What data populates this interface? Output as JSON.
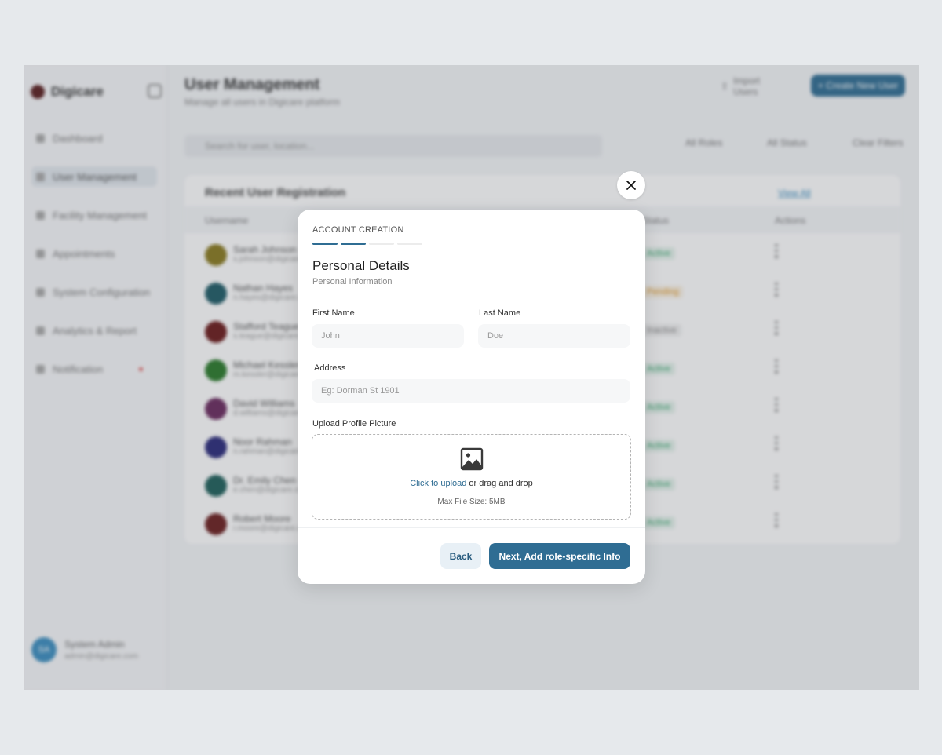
{
  "background": {
    "app_name": "Digicare",
    "page_title": "User Management",
    "page_subtitle": "Manage all users in Digicare platform",
    "import_label": "Import Users",
    "create_label": "+ Create New User",
    "search_placeholder": "Search for user, location...",
    "filters": [
      "All Roles",
      "All Status",
      "Clear Filters"
    ],
    "sidebar": [
      {
        "label": "Dashboard"
      },
      {
        "label": "User Management"
      },
      {
        "label": "Facility Management"
      },
      {
        "label": "Appointments"
      },
      {
        "label": "System Configuration"
      },
      {
        "label": "Analytics & Report"
      },
      {
        "label": "Notification"
      }
    ],
    "user_card": {
      "initials": "SA",
      "name": "System Admin",
      "email": "admin@digicare.com"
    },
    "table": {
      "title": "Recent User Registration",
      "view_all": "View All",
      "columns": [
        "Username",
        "Status",
        "Actions"
      ],
      "rows": [
        {
          "name": "Sarah Johnson",
          "email": "s.johnson@digicare.com",
          "avatar_color": "#8a7a1e",
          "status": "Active",
          "status_color": "#3aa870"
        },
        {
          "name": "Nathan Hayes",
          "email": "n.hayes@digicare.com",
          "avatar_color": "#1e5b66",
          "status": "Pending",
          "status_color": "#e09a2d"
        },
        {
          "name": "Stafford Teague",
          "email": "s.teague@digicare.com",
          "avatar_color": "#6b1a1a",
          "status": "Inactive",
          "status_color": "#888888"
        },
        {
          "name": "Michael Kessler",
          "email": "m.kessler@digicare.com",
          "avatar_color": "#2a7a2a",
          "status": "Active",
          "status_color": "#3aa870"
        },
        {
          "name": "David Williams",
          "email": "d.williams@digicare.com",
          "avatar_color": "#6a2a5e",
          "status": "Active",
          "status_color": "#3aa870"
        },
        {
          "name": "Noor Rahman",
          "email": "n.rahman@digicare.com",
          "avatar_color": "#2a2a7a",
          "status": "Active",
          "status_color": "#3aa870"
        },
        {
          "name": "Dr. Emily Chen",
          "email": "e.chen@digicare.com",
          "avatar_color": "#1e5f5a",
          "status": "Active",
          "status_color": "#3aa870"
        },
        {
          "name": "Robert Moore",
          "email": "r.moore@digicare.com",
          "avatar_color": "#6b1e1e",
          "status": "Active",
          "status_color": "#3aa870"
        }
      ]
    }
  },
  "modal": {
    "step_label": "ACCOUNT CREATION",
    "progress": {
      "total_steps": 4,
      "completed_steps": 2
    },
    "title": "Personal Details",
    "subtitle": "Personal Information",
    "first_name": {
      "label": "First Name",
      "placeholder": "John",
      "value": ""
    },
    "last_name": {
      "label": "Last Name",
      "placeholder": "Doe",
      "value": ""
    },
    "address": {
      "label": "Address",
      "placeholder": "Eg: Dorman St 1901",
      "value": ""
    },
    "upload": {
      "label": "Upload Profile Picture",
      "link_text": "Click to upload",
      "rest_text": " or drag and drop",
      "max_size": "Max File Size: 5MB",
      "icon": "image-icon"
    },
    "back_label": "Back",
    "next_label": "Next, Add role-specific Info",
    "close_icon": "close-icon"
  },
  "colors": {
    "primary": "#2f6d93",
    "secondary_bg": "#e8f0f6",
    "page_bg": "#e6e9ec"
  }
}
